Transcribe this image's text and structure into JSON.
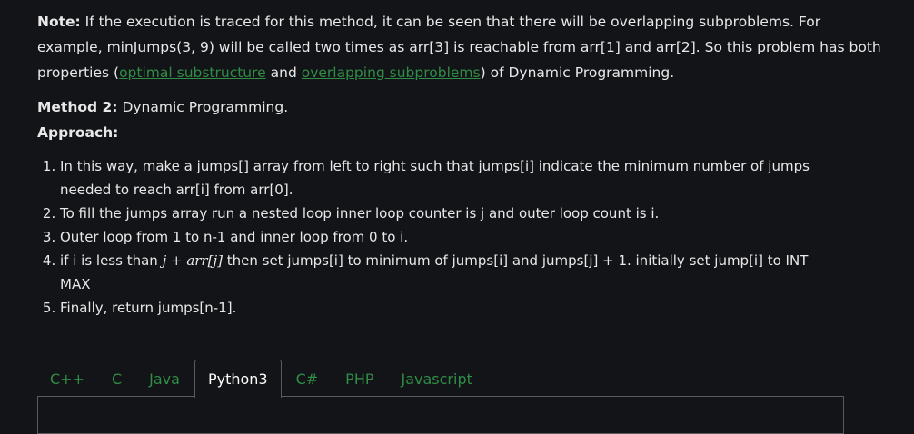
{
  "note": {
    "label": "Note:",
    "text_1": " If the execution is traced for this method, it can be seen that there will be overlapping subproblems. For example, minJumps(3, 9) will be called two times as arr[3] is reachable from arr[1] and arr[2]. So this problem has both properties (",
    "link_1": "optimal substructure",
    "text_2": " and ",
    "link_2": "overlapping subproblems",
    "text_3": ") of Dynamic Programming."
  },
  "method": {
    "label": "Method 2:",
    "text": " Dynamic Programming."
  },
  "approach_label": "Approach:",
  "steps": [
    "In this way, make a jumps[] array from left to right such that jumps[i] indicate the minimum number of jumps needed to reach arr[i] from arr[0].",
    "To fill the jumps array run a nested loop inner loop counter is j and outer loop count is i.",
    "Outer loop from 1 to n-1 and inner loop from 0 to i.",
    {
      "pre": "if i is less than ",
      "math": "j + arr[j]",
      "post": " then set jumps[i] to minimum of jumps[i] and jumps[j] + 1. initially set jump[i] to INT MAX"
    },
    "Finally, return jumps[n-1]."
  ],
  "tabs": [
    "C++",
    "C",
    "Java",
    "Python3",
    "C#",
    "PHP",
    "Javascript"
  ],
  "active_tab": "Python3",
  "colors": {
    "link": "#2f8d46",
    "background": "#131417",
    "text": "#e8e8e8"
  }
}
